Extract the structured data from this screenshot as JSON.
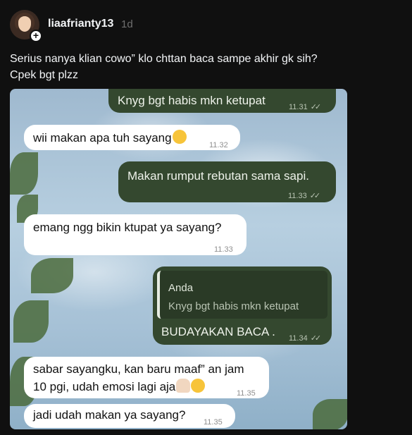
{
  "post": {
    "username": "liaafrianty13",
    "age": "1d",
    "caption_line1": "Serius nanya klian cowo” klo chttan baca sampe akhir gk sih?",
    "caption_line2": "Cpek bgt plzz"
  },
  "chat": {
    "messages": [
      {
        "dir": "out",
        "text": "Knyg bgt habis mkn ketupat",
        "time": "11.31"
      },
      {
        "dir": "in",
        "text": "wii makan apa tuh sayang",
        "time": "11.32",
        "emoji": "shushing-face-emoji"
      },
      {
        "dir": "out",
        "text": "Makan rumput rebutan sama sapi.",
        "time": "11.33"
      },
      {
        "dir": "in",
        "text": "emang ngg bikin ktupat ya sayang?",
        "time": "11.33"
      },
      {
        "dir": "out",
        "quote_name": "Anda",
        "quote_text": "Knyg bgt habis mkn ketupat",
        "text": "BUDAYAKAN BACA .",
        "time": "11.34"
      },
      {
        "dir": "in",
        "text_line1": "sabar sayangku, kan baru maaf” an jam",
        "text_line2": "10 pgi, udah emosi lagi aja",
        "time": "11.35",
        "emoji": [
          "folded-hands-emoji",
          "pleading-face-emoji"
        ]
      },
      {
        "dir": "in",
        "text": "jadi udah makan ya sayang?",
        "time": "11.35"
      }
    ],
    "read_ticks": "✓✓"
  }
}
